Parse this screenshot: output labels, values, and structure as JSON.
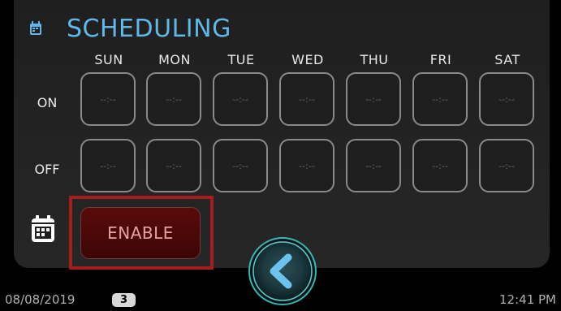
{
  "header": {
    "title": "SCHEDULING",
    "icon": "schedule-icon"
  },
  "days": [
    "SUN",
    "MON",
    "TUE",
    "WED",
    "THU",
    "FRI",
    "SAT"
  ],
  "rows": [
    {
      "label": "ON",
      "values": [
        "--:--",
        "--:--",
        "--:--",
        "--:--",
        "--:--",
        "--:--",
        "--:--"
      ]
    },
    {
      "label": "OFF",
      "values": [
        "--:--",
        "--:--",
        "--:--",
        "--:--",
        "--:--",
        "--:--",
        "--:--"
      ]
    }
  ],
  "controls": {
    "enable_label": "ENABLE",
    "calendar_icon": "calendar-icon",
    "back_icon": "chevron-left-icon"
  },
  "status_bar": {
    "date": "08/08/2019",
    "badge": "3",
    "time": "12:41 PM"
  },
  "colors": {
    "accent": "#5fb8e8",
    "enable_bg": "#4a0808",
    "highlight_border": "#a51d1d",
    "back_button_glow": "#3ec6c6"
  }
}
